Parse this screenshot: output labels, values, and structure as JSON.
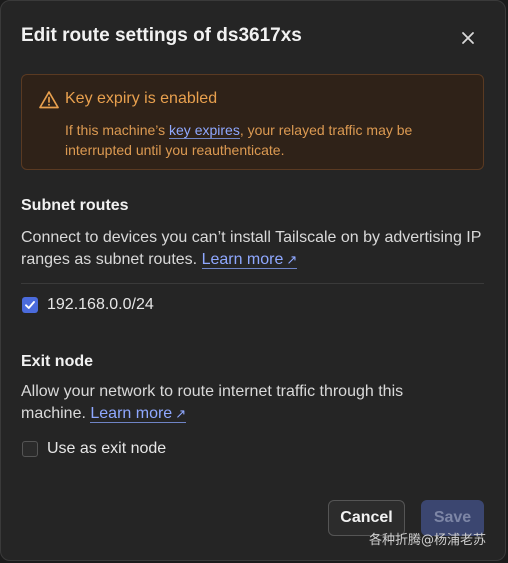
{
  "dialog": {
    "title": "Edit route settings of ds3617xs"
  },
  "warning": {
    "title": "Key expiry is enabled",
    "body_prefix": "If this machine’s ",
    "body_link": "key expires",
    "body_suffix": ", your relayed traffic may be interrupted until you reauthenticate.",
    "color": "#e8a04e"
  },
  "subnet": {
    "heading": "Subnet routes",
    "description": "Connect to devices you can’t install Tailscale on by advertising IP ranges as subnet routes.",
    "learn_more": "Learn more",
    "routes": [
      {
        "label": "192.168.0.0/24",
        "checked": true
      }
    ]
  },
  "exit_node": {
    "heading": "Exit node",
    "description": "Allow your network to route internet traffic through this machine.",
    "learn_more": "Learn more",
    "option_label": "Use as exit node",
    "checked": false
  },
  "actions": {
    "cancel": "Cancel",
    "save": "Save"
  },
  "watermark": "各种折腾@杨浦老苏",
  "accent_color": "#4b6bdc",
  "link_color": "#8fa8ff"
}
